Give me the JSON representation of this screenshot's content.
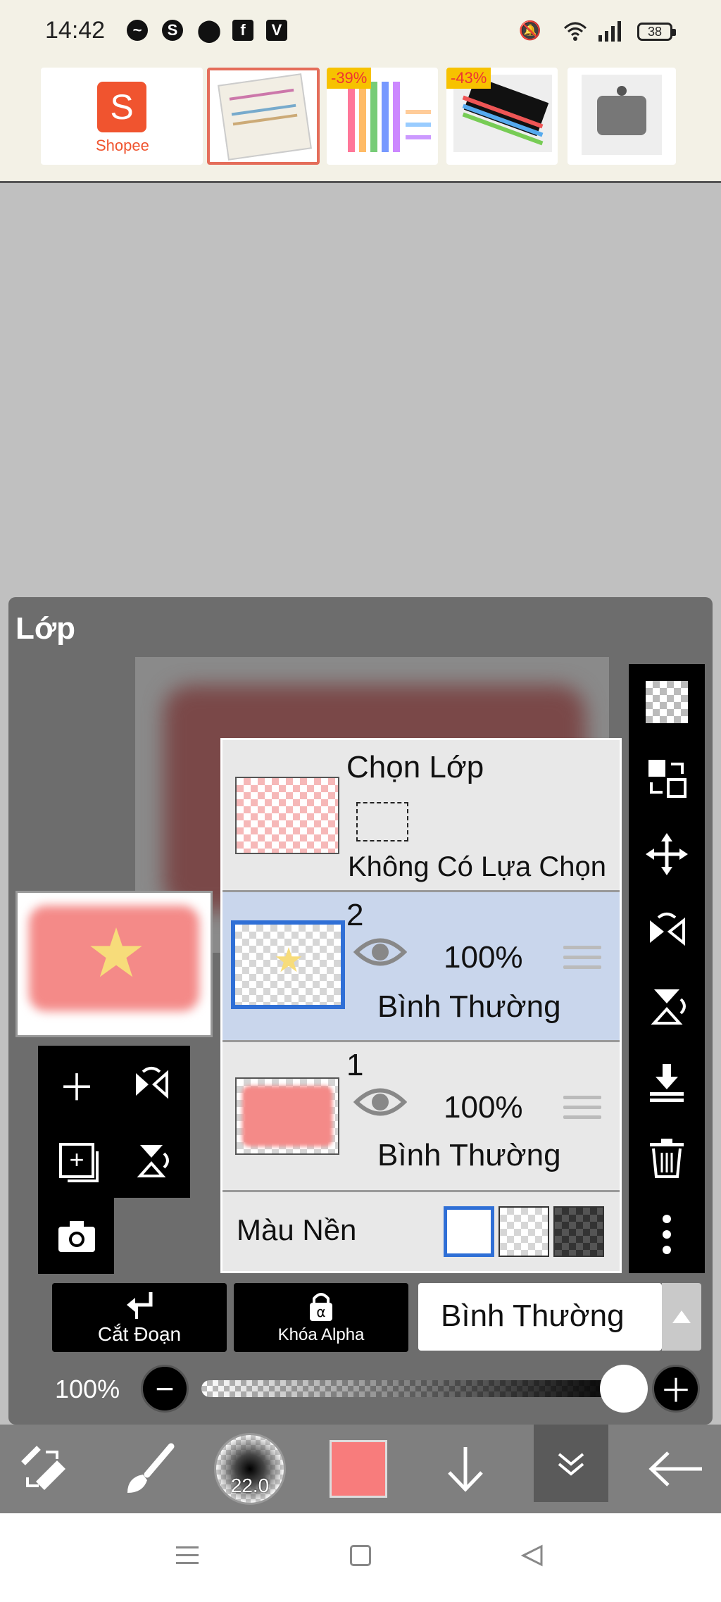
{
  "status_bar": {
    "time": "14:42",
    "battery": "38",
    "icons": [
      "messenger-icon",
      "skype-icon",
      "location-icon",
      "facebook-icon",
      "app-icon",
      "mute-icon",
      "wifi-icon",
      "signal-icon",
      "battery-icon"
    ]
  },
  "ad_bar": {
    "brand_label": "Shopee",
    "products": [
      {
        "name": "notebook-product",
        "discount": ""
      },
      {
        "name": "highlighter-product",
        "discount": "-39%"
      },
      {
        "name": "pen-product",
        "discount": "-43%"
      },
      {
        "name": "motor-product",
        "discount": ""
      }
    ]
  },
  "panel": {
    "title": "Lớp",
    "selection_layer": {
      "title": "Chọn Lớp",
      "subtitle": "Không Có Lựa Chọn"
    },
    "layers": [
      {
        "number": "2",
        "opacity": "100%",
        "blend": "Bình Thường",
        "selected": true
      },
      {
        "number": "1",
        "opacity": "100%",
        "blend": "Bình Thường",
        "selected": false
      }
    ],
    "background": {
      "label": "Màu Nền",
      "options": [
        "white",
        "transparent",
        "dark"
      ],
      "selected": "white"
    },
    "clip_button": "Cắt Đoạn",
    "alpha_lock_button": "Khóa Alpha",
    "blend_mode": "Bình Thường",
    "opacity_label": "100%",
    "opacity_value": 1.0
  },
  "colors": {
    "accent_blue": "#2f6fd6",
    "flag_red": "#f48a88",
    "star_yellow": "#f7dc7a",
    "current_color": "#f87c7c"
  },
  "toolbar": {
    "brush_size": "22.0"
  }
}
